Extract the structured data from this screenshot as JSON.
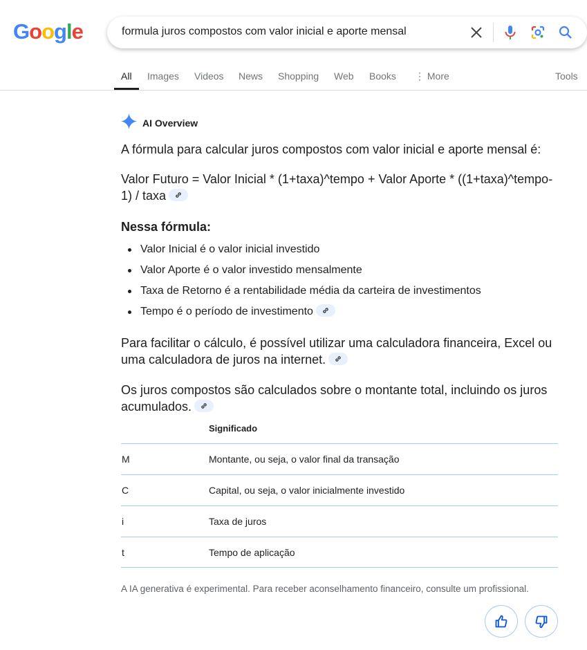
{
  "search": {
    "query": "formula juros compostos com valor inicial e aporte mensal"
  },
  "logo": "Google",
  "tabs": [
    "All",
    "Images",
    "Videos",
    "News",
    "Shopping",
    "Web",
    "Books",
    "More"
  ],
  "tools_label": "Tools",
  "ai_overview": {
    "title": "AI Overview",
    "intro": "A fórmula para calcular juros compostos com valor inicial e aporte mensal é:",
    "formula": "Valor Futuro = Valor Inicial * (1+taxa)^tempo + Valor Aporte * ((1+taxa)^tempo-1) / taxa",
    "heading": "Nessa fórmula:",
    "bullets": [
      "Valor Inicial é o valor inicial investido",
      "Valor Aporte é o valor investido mensalmente",
      "Taxa de Retorno é a rentabilidade média da carteira de investimentos",
      "Tempo é o período de investimento"
    ],
    "para1": "Para facilitar o cálculo, é possível utilizar uma calculadora financeira, Excel ou uma calculadora de juros na internet.",
    "para2": "Os juros compostos são calculados sobre o montante total, incluindo os juros acumulados.",
    "table": {
      "header": "Significado",
      "rows": [
        [
          "M",
          "Montante, ou seja, o valor final da transação"
        ],
        [
          "C",
          "Capital, ou seja, o valor inicialmente investido"
        ],
        [
          "i",
          "Taxa de juros"
        ],
        [
          "t",
          "Tempo de aplicação"
        ]
      ]
    },
    "disclaimer": "A IA generativa é experimental. Para receber aconselhamento financeiro, consulte um profissional."
  },
  "colors": {
    "accent": "#0b57d0",
    "link_chip": "#e8f0fe",
    "table_border": "#a8c7fa"
  }
}
